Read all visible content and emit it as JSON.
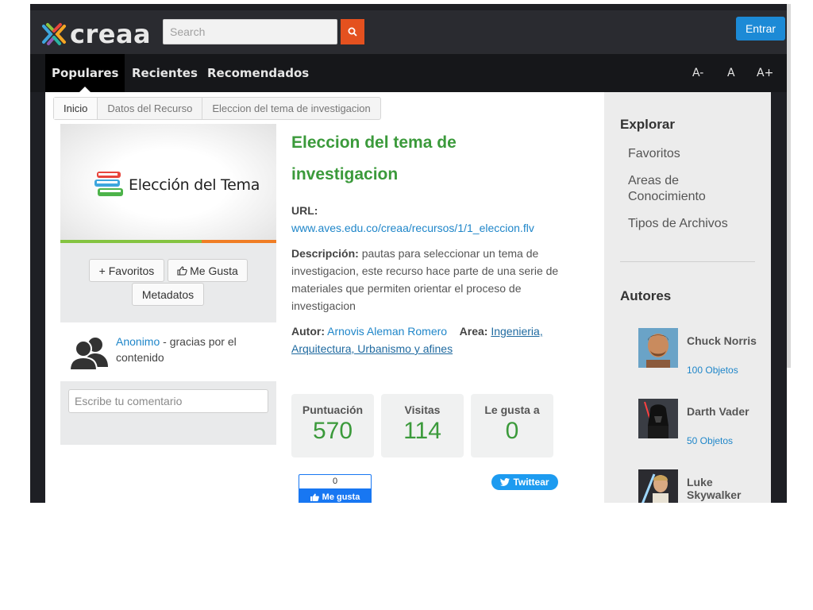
{
  "header": {
    "logo_text": "creaa",
    "search_placeholder": "Search",
    "login_label": "Entrar"
  },
  "nav": {
    "tabs": [
      {
        "label": "Populares",
        "active": true
      },
      {
        "label": "Recientes",
        "active": false
      },
      {
        "label": "Recomendados",
        "active": false
      }
    ],
    "font_controls": [
      "A-",
      "A",
      "A+"
    ]
  },
  "breadcrumb": [
    "Inicio",
    "Datos del Recurso",
    "Eleccion del tema de investigacion"
  ],
  "resource": {
    "thumbnail_text": "Elección del Tema",
    "title_line1": "Eleccion del tema de",
    "title_line2": "investigacion",
    "url_label": "URL:",
    "url": "www.aves.edu.co/creaa/recursos/1/1_eleccion.flv",
    "description_label": "Descripción:",
    "description": "pautas para seleccionar un tema de investigacion, este recurso hace parte de una serie de materiales que permiten orientar el proceso de investigacion",
    "author_label": "Autor:",
    "author": "Arnovis Aleman Romero",
    "area_label": "Area:",
    "area_part1": "Ingenieria,",
    "area_part2": "Arquitectura, Urbanismo y afines"
  },
  "actions": {
    "favorites": "+ Favoritos",
    "like": "Me Gusta",
    "metadata": "Metadatos"
  },
  "comment": {
    "user": "Anonimo",
    "text": " - gracias por el contenido",
    "input_placeholder": "Escribe tu comentario"
  },
  "stats": [
    {
      "label": "Puntuación",
      "value": "570"
    },
    {
      "label": "Visitas",
      "value": "114"
    },
    {
      "label": "Le gusta a",
      "value": "0"
    }
  ],
  "social": {
    "fb_count": "0",
    "fb_label": "Me gusta",
    "tw_label": "Twittear"
  },
  "sidebar": {
    "explore_title": "Explorar",
    "explore_links": [
      "Favoritos",
      "Areas de Conocimiento",
      "Tipos de Archivos"
    ],
    "authors_title": "Autores",
    "authors": [
      {
        "name": "Chuck Norris",
        "count": "100 Objetos"
      },
      {
        "name": "Darth Vader",
        "count": "50 Objetos"
      },
      {
        "name": "Luke Skywalker",
        "count": ""
      }
    ]
  },
  "colors": {
    "accent_green": "#3b9a3b",
    "link_blue": "#1f86c9",
    "search_orange": "#e4511f",
    "login_blue": "#1c8ad6"
  }
}
